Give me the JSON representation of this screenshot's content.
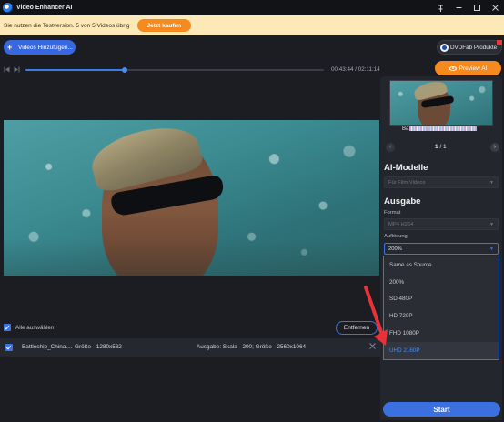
{
  "window": {
    "title": "Video Enhancer AI",
    "controls": [
      "pin-icon",
      "minimize-icon",
      "maximize-icon",
      "close-icon"
    ]
  },
  "trial": {
    "message": "Sie nutzen die Testversion. 5 von 5 Videos übrig",
    "buy_label": "Jetzt kaufen"
  },
  "toolbar": {
    "add_videos_label": "Videos Hinzufügen...",
    "dvdfab_label": "DVDFab Produkte",
    "preview_label": "Preview AI"
  },
  "player": {
    "time": "00:43:44 / 02:11:14",
    "progress_fraction": 0.333
  },
  "list": {
    "select_all_label": "Alle auswählen",
    "remove_label": "Entfernen",
    "file": {
      "name": "Battleship_China....",
      "size": "Größe - 1280x532",
      "output": "Ausgabe: Skala - 200; Größe - 2560x1064"
    }
  },
  "sidebar": {
    "thumbnail_caption": "Ba",
    "pager": {
      "current": "1",
      "total": "/ 1"
    },
    "ai_models": {
      "title": "AI-Modelle",
      "value": "Für Film Videos"
    },
    "output": {
      "title": "Ausgabe",
      "format_label": "Format",
      "format_value": "MP4 H264",
      "resolution_label": "Auflösung",
      "resolution_value": "200%",
      "resolution_options": [
        "Same as Source",
        "200%",
        "SD 480P",
        "HD 720P",
        "FHD 1080P",
        "UHD 2160P"
      ]
    },
    "start_label": "Start"
  },
  "colors": {
    "accent_blue": "#3b70e0",
    "accent_orange": "#f78a1e",
    "trial_bg": "#fde8b8",
    "annotation_red": "#e8323a"
  }
}
